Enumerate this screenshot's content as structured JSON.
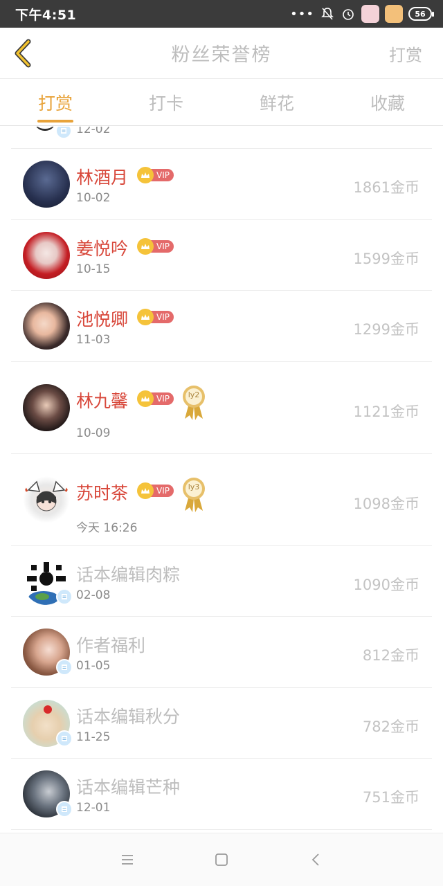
{
  "status_bar": {
    "time": "下午4:51",
    "dots": "•••",
    "battery": "56"
  },
  "header": {
    "title": "粉丝荣誉榜",
    "action": "打赏",
    "back_icon": "chevron-left-icon"
  },
  "tabs": [
    {
      "label": "打赏",
      "active": true
    },
    {
      "label": "打卡",
      "active": false
    },
    {
      "label": "鲜花",
      "active": false
    },
    {
      "label": "收藏",
      "active": false
    }
  ],
  "partial_row": {
    "date": "12-02"
  },
  "rows": [
    {
      "name": "林酒月",
      "vip": "VIP",
      "date": "10-02",
      "coins": "1861金币"
    },
    {
      "name": "姜悦吟",
      "vip": "VIP",
      "date": "10-15",
      "coins": "1599金币"
    },
    {
      "name": "池悦卿",
      "vip": "VIP",
      "date": "11-03",
      "coins": "1299金币"
    },
    {
      "name": "林九馨",
      "vip": "VIP",
      "level": "ly2",
      "date": "10-09",
      "coins": "1121金币"
    },
    {
      "name": "苏时茶",
      "vip": "VIP",
      "level": "ly3",
      "date": "今天 16:26",
      "coins": "1098金币"
    },
    {
      "name": "话本编辑肉粽",
      "date": "02-08",
      "coins": "1090金币"
    },
    {
      "name": "作者福利",
      "date": "01-05",
      "coins": "812金币"
    },
    {
      "name": "话本编辑秋分",
      "date": "11-25",
      "coins": "782金币"
    },
    {
      "name": "话本编辑芒种",
      "date": "12-01",
      "coins": "751金币"
    }
  ],
  "colors": {
    "accent": "#e8a33a",
    "vip_name": "#d8473a",
    "muted": "#bdbdbd"
  }
}
